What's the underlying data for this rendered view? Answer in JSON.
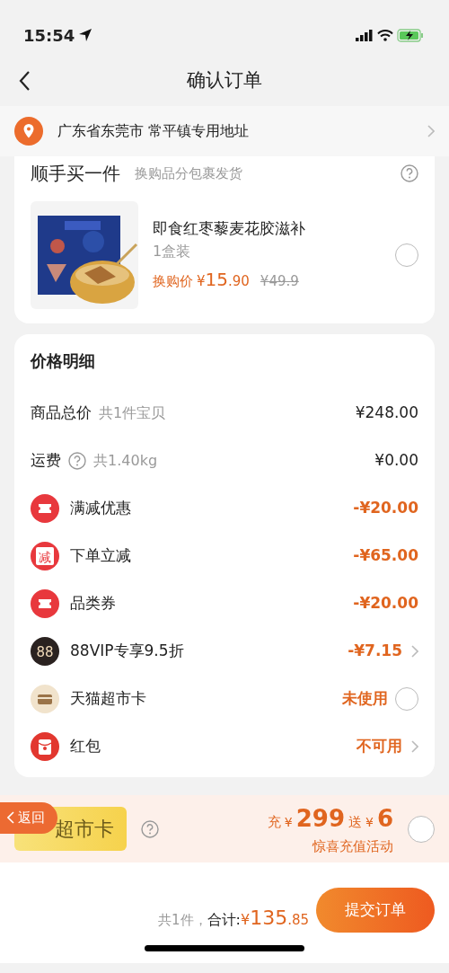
{
  "status_bar": {
    "time": "15:54"
  },
  "nav": {
    "title": "确认订单"
  },
  "address": {
    "text": "广东省东莞市 常平镇专用地址"
  },
  "addon": {
    "title": "顺手买一件",
    "subtitle": "换购品分包裹发货",
    "product": {
      "name": "即食红枣藜麦花胶滋补",
      "spec": "1盒装",
      "price_label": "换购价",
      "currency": "¥",
      "price_int": "15",
      "price_dec": ".90",
      "original": "¥49.9",
      "selected": false
    }
  },
  "price_detail": {
    "title": "价格明细",
    "rows": [
      {
        "kind": "plain",
        "label": "商品总价",
        "note": "共1件宝贝",
        "help": false,
        "value": "¥248.00"
      },
      {
        "kind": "plain",
        "label": "运费",
        "note": "共1.40kg",
        "help": true,
        "value": "¥0.00"
      },
      {
        "kind": "discount",
        "label": "满减优惠",
        "value": "-¥20.00",
        "chevron": false
      },
      {
        "kind": "discount",
        "icon_text": "减",
        "label": "下单立减",
        "value": "-¥65.00",
        "chevron": false
      },
      {
        "kind": "discount",
        "label": "品类券",
        "value": "-¥20.00",
        "chevron": false
      },
      {
        "kind": "discount",
        "icon_text": "88",
        "label": "88VIP专享9.5折",
        "value": "-¥7.15",
        "chevron": true
      },
      {
        "kind": "choice",
        "label": "天猫超市卡",
        "value": "未使用",
        "selected": false
      },
      {
        "kind": "discount",
        "label": "红包",
        "value": "不可用",
        "chevron": true
      }
    ]
  },
  "promo": {
    "card_label": "超市卡",
    "recharge_label": "充",
    "currency": "¥",
    "recharge_amount": "299",
    "gift_label": "送",
    "gift_currency": "¥",
    "gift_amount": "6",
    "caption": "惊喜充值活动",
    "selected": false
  },
  "back_pill": {
    "label": "返回"
  },
  "footer": {
    "count": "共1件，",
    "total_label": "合计:",
    "currency": "¥",
    "total_int": "135",
    "total_dec": ".85",
    "submit": "提交订单"
  }
}
